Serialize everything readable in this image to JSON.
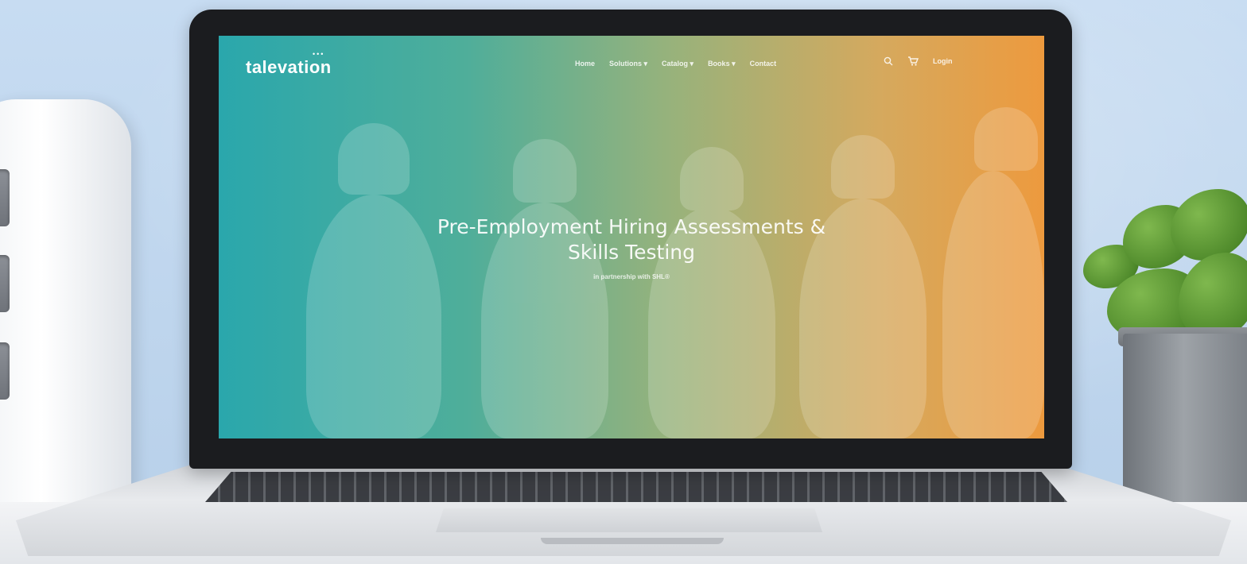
{
  "site": {
    "logo_text": "talevation",
    "logo_dots": "•••",
    "nav": {
      "items": [
        {
          "label": "Home"
        },
        {
          "label": "Solutions ▾"
        },
        {
          "label": "Catalog ▾"
        },
        {
          "label": "Books ▾"
        },
        {
          "label": "Contact"
        }
      ],
      "login_label": "Login"
    },
    "hero": {
      "title_line1": "Pre-Employment Hiring Assessments &",
      "title_line2": "Skills Testing",
      "subtitle": "in partnership with SHL®"
    }
  },
  "icons": {
    "search": "search-icon",
    "cart": "cart-icon"
  },
  "colors": {
    "gradient_start": "#2aa7ac",
    "gradient_end": "#ed9a3e",
    "text": "#ffffff"
  }
}
